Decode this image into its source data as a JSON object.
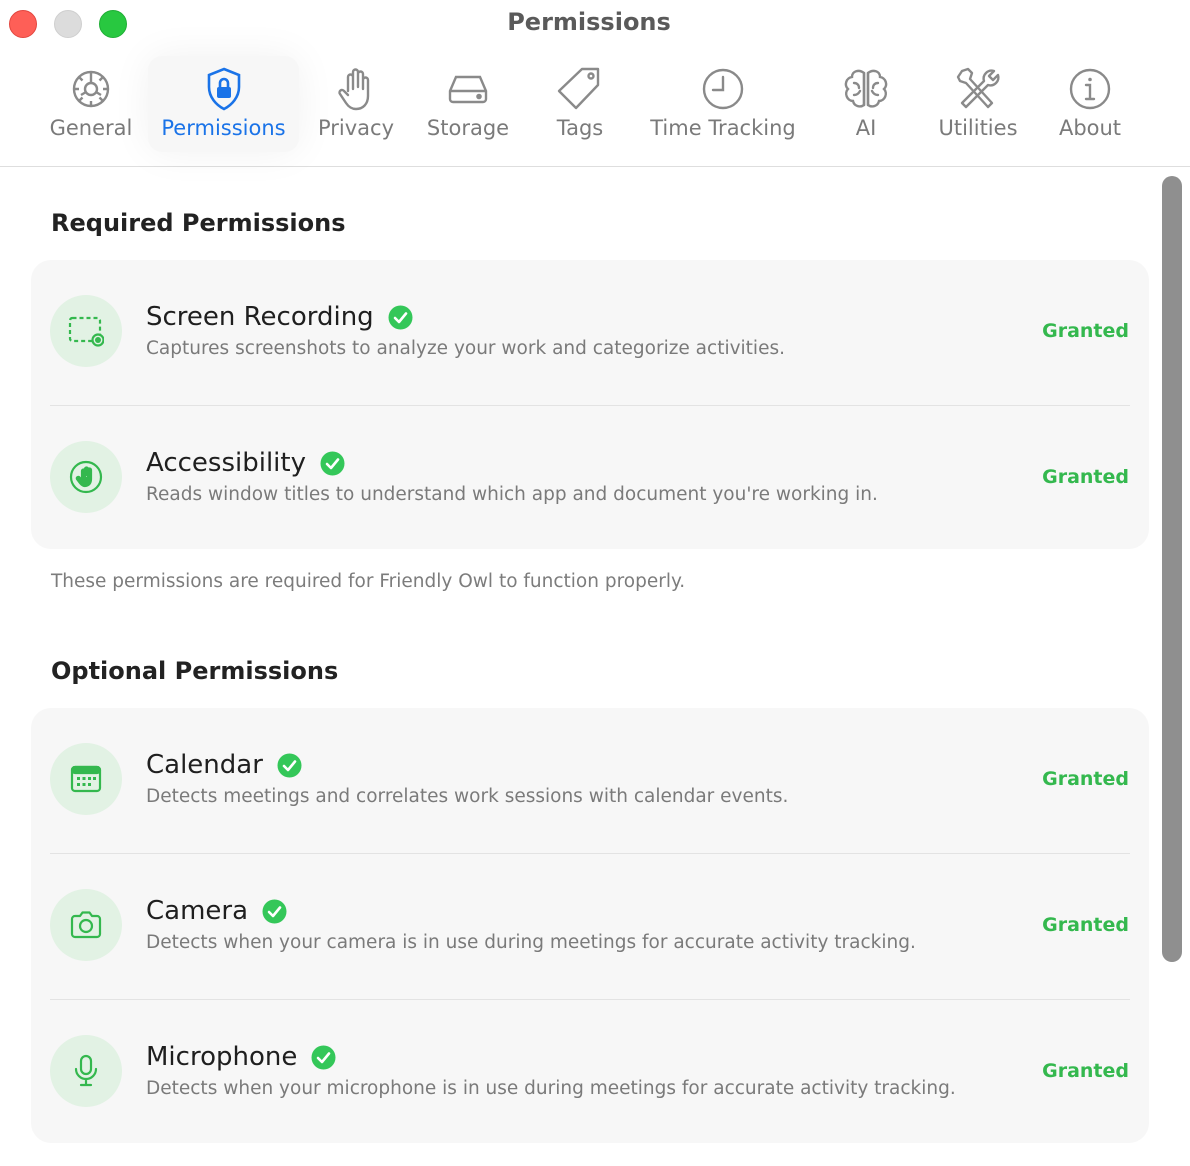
{
  "window": {
    "title": "Permissions"
  },
  "tabs": [
    {
      "label": "General",
      "icon": "gear-icon"
    },
    {
      "label": "Permissions",
      "icon": "lock-shield-icon",
      "active": true
    },
    {
      "label": "Privacy",
      "icon": "hand-icon"
    },
    {
      "label": "Storage",
      "icon": "drive-icon"
    },
    {
      "label": "Tags",
      "icon": "tag-icon"
    },
    {
      "label": "Time Tracking",
      "icon": "clock-icon"
    },
    {
      "label": "AI",
      "icon": "brain-icon"
    },
    {
      "label": "Utilities",
      "icon": "tools-icon"
    },
    {
      "label": "About",
      "icon": "info-icon"
    }
  ],
  "required": {
    "title": "Required Permissions",
    "items": [
      {
        "title": "Screen Recording",
        "description": "Captures screenshots to analyze your work and categorize activities.",
        "status": "Granted",
        "icon": "screen-recording-icon"
      },
      {
        "title": "Accessibility",
        "description": "Reads window titles to understand which app and document you're working in.",
        "status": "Granted",
        "icon": "accessibility-hand-icon"
      }
    ],
    "note": "These permissions are required for Friendly Owl to function properly."
  },
  "optional": {
    "title": "Optional Permissions",
    "items": [
      {
        "title": "Calendar",
        "description": "Detects meetings and correlates work sessions with calendar events.",
        "status": "Granted",
        "icon": "calendar-icon"
      },
      {
        "title": "Camera",
        "description": "Detects when your camera is in use during meetings for accurate activity tracking.",
        "status": "Granted",
        "icon": "camera-icon"
      },
      {
        "title": "Microphone",
        "description": "Detects when your microphone is in use during meetings for accurate activity tracking.",
        "status": "Granted",
        "icon": "microphone-icon"
      }
    ]
  },
  "colors": {
    "accent": "#1a73e8",
    "granted": "#34b84e",
    "icon_bg": "#e2f2e4"
  }
}
